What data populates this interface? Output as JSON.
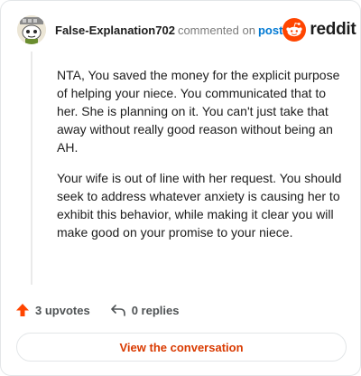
{
  "header": {
    "username": "False-Explanation702",
    "verb": "commented on",
    "post_link": "post",
    "brand": "reddit"
  },
  "comment": {
    "paragraphs": [
      "NTA, You saved the money for the explicit purpose of helping your niece. You communicated that to her. She is planning on it. You can't just take that away without really good reason without being an AH.",
      "Your wife is out of line with her request. You should seek to address whatever anxiety is causing her to exhibit this behavior, while making it clear you will make good on your promise to your niece."
    ]
  },
  "actions": {
    "upvotes": "3 upvotes",
    "replies": "0 replies"
  },
  "cta": {
    "label": "View the conversation"
  },
  "colors": {
    "reddit_orange": "#ff4500",
    "link_blue": "#0079d3",
    "cta_text": "#d93a00"
  },
  "icons": {
    "avatar": "snoo-avatar",
    "logo": "reddit-snoo-logo",
    "upvote": "upvote-arrow-icon",
    "reply": "reply-arrow-icon"
  }
}
